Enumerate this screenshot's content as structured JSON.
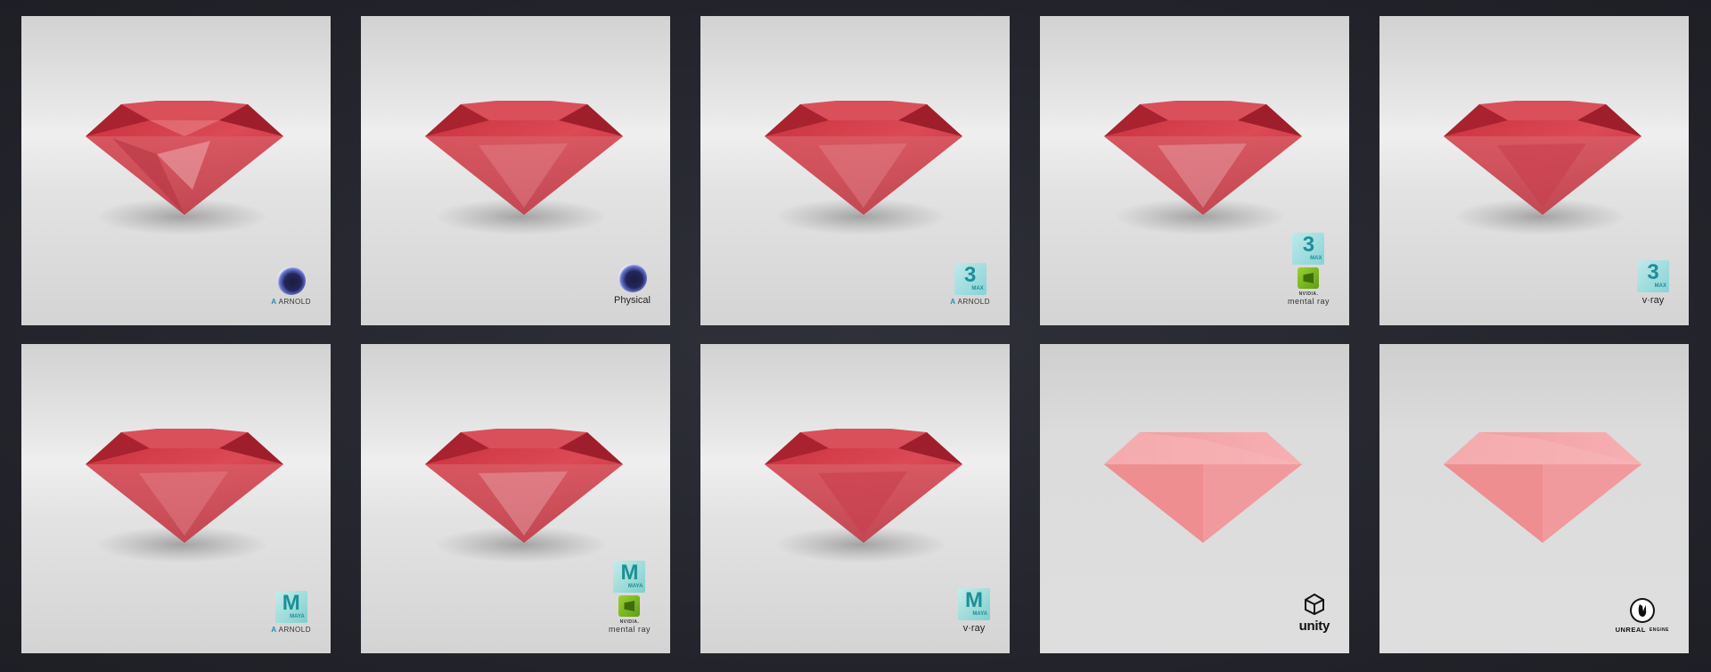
{
  "colors": {
    "background": "#25262d",
    "gem_dark": "#b52a35",
    "gem_mid": "#d6424c",
    "gem_light": "#e88a90",
    "gem_flat_light": "#f5a5a7",
    "gem_flat_mid": "#ec8d90"
  },
  "tiles": [
    {
      "style": "glossy",
      "logos": [
        "cinema4d-icon",
        "arnold-icon"
      ],
      "labels": {
        "renderer": "ARNOLD"
      }
    },
    {
      "style": "glossy",
      "logos": [
        "cinema4d-icon"
      ],
      "labels": {
        "renderer": "Physical"
      }
    },
    {
      "style": "glossy",
      "logos": [
        "3dsmax-icon",
        "arnold-icon"
      ],
      "labels": {
        "app_letter": "3",
        "app_sub": "MAX",
        "renderer": "ARNOLD"
      }
    },
    {
      "style": "glossy",
      "logos": [
        "3dsmax-icon",
        "nvidia-icon"
      ],
      "labels": {
        "app_letter": "3",
        "app_sub": "MAX",
        "renderer": "mental ray",
        "vendor": "NVIDIA."
      }
    },
    {
      "style": "glossy",
      "logos": [
        "3dsmax-icon",
        "vray-icon"
      ],
      "labels": {
        "app_letter": "3",
        "app_sub": "MAX",
        "renderer": "v·ray"
      }
    },
    {
      "style": "glossy",
      "logos": [
        "maya-icon",
        "arnold-icon"
      ],
      "labels": {
        "app_letter": "M",
        "app_sub": "MAYA",
        "renderer": "ARNOLD"
      }
    },
    {
      "style": "glossy",
      "logos": [
        "maya-icon",
        "nvidia-icon"
      ],
      "labels": {
        "app_letter": "M",
        "app_sub": "MAYA",
        "renderer": "mental ray",
        "vendor": "NVIDIA."
      }
    },
    {
      "style": "glossy",
      "logos": [
        "maya-icon",
        "vray-icon"
      ],
      "labels": {
        "app_letter": "M",
        "app_sub": "MAYA",
        "renderer": "v·ray"
      }
    },
    {
      "style": "flat",
      "logos": [
        "unity-icon"
      ],
      "labels": {
        "renderer": "unity"
      }
    },
    {
      "style": "flat",
      "logos": [
        "unreal-engine-icon"
      ],
      "labels": {
        "renderer_line1": "UNREAL",
        "renderer_line2": "ENGINE"
      }
    }
  ]
}
